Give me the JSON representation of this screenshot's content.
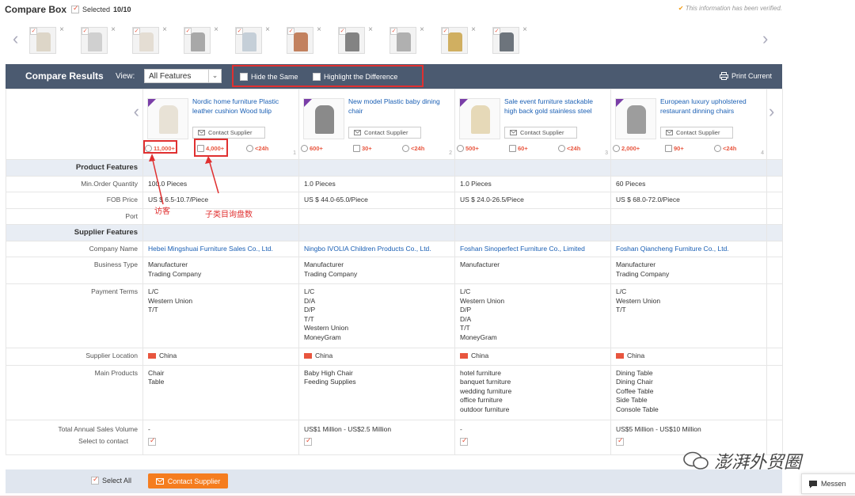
{
  "topbar": {
    "title": "Compare Box",
    "selected_label": "Selected",
    "selected_count": "10/10",
    "verified_text": "This information has been verified."
  },
  "thumbs": [
    "chair-white",
    "baby-chair",
    "chair-white-2",
    "chair-gray",
    "shelf",
    "chairs-multi",
    "room",
    "chair-gray-2",
    "chairs-multi-2",
    "dining-set"
  ],
  "header": {
    "title": "Compare Results",
    "view_label": "View:",
    "view_value": "All Features",
    "hide_same": "Hide the Same",
    "highlight_diff": "Highlight the Difference",
    "print": "Print Current"
  },
  "products": [
    {
      "name": "Nordic home furniture Plastic leather cushion Wood tulip",
      "contact": "Contact Supplier",
      "views": "11,000+",
      "inquiries": "4,000+",
      "response": "<24h",
      "index": "1"
    },
    {
      "name": "New model Plastic baby dining chair",
      "contact": "Contact Supplier",
      "views": "600+",
      "inquiries": "30+",
      "response": "<24h",
      "index": "2"
    },
    {
      "name": "Sale event furniture stackable high back gold stainless steel",
      "contact": "Contact Supplier",
      "views": "500+",
      "inquiries": "60+",
      "response": "<24h",
      "index": "3"
    },
    {
      "name": "European luxury upholstered restaurant dinning chairs",
      "contact": "Contact Supplier",
      "views": "2,000+",
      "inquiries": "90+",
      "response": "<24h",
      "index": "4"
    }
  ],
  "sections": {
    "product": "Product Features",
    "supplier": "Supplier Features"
  },
  "labels": {
    "moq": "Min.Order Quantity",
    "fob": "FOB Price",
    "port": "Port",
    "company": "Company Name",
    "business": "Business Type",
    "payment": "Payment Terms",
    "location": "Supplier Location",
    "main_products": "Main Products",
    "annual_sales": "Total Annual Sales Volume",
    "select_contact": "Select to contact"
  },
  "rows": {
    "moq": [
      "100.0 Pieces",
      "1.0 Pieces",
      "1.0 Pieces",
      "60 Pieces"
    ],
    "fob": [
      "US $ 6.5-10.7/Piece",
      "US $ 44.0-65.0/Piece",
      "US $ 24.0-26.5/Piece",
      "US $ 68.0-72.0/Piece"
    ],
    "company": [
      "Hebei Mingshuai Furniture Sales Co., Ltd.",
      "Ningbo IVOLIA Children Products Co., Ltd.",
      "Foshan Sinoperfect Furniture Co., Limited",
      "Foshan Qiancheng Furniture Co., Ltd."
    ],
    "business": [
      [
        "Manufacturer",
        "Trading Company"
      ],
      [
        "Manufacturer",
        "Trading Company"
      ],
      [
        "Manufacturer"
      ],
      [
        "Manufacturer",
        "Trading Company"
      ]
    ],
    "payment": [
      [
        "L/C",
        "Western Union",
        "T/T"
      ],
      [
        "L/C",
        "D/A",
        "D/P",
        "T/T",
        "Western Union",
        "MoneyGram"
      ],
      [
        "L/C",
        "Western Union",
        "D/P",
        "D/A",
        "T/T",
        "MoneyGram"
      ],
      [
        "L/C",
        "Western Union",
        "T/T"
      ]
    ],
    "location": [
      "China",
      "China",
      "China",
      "China"
    ],
    "main_products": [
      [
        "Chair",
        "Table"
      ],
      [
        "Baby High Chair",
        "Feeding Supplies"
      ],
      [
        "hotel furniture",
        "banquet furniture",
        "wedding furniture",
        "office furniture",
        "outdoor furniture"
      ],
      [
        "Dining Table",
        "Dining Chair",
        "Coffee Table",
        "Side Table",
        "Console Table"
      ]
    ],
    "annual_sales": [
      "-",
      "US$1 Million - US$2.5 Million",
      "-",
      "US$5 Million - US$10 Million"
    ]
  },
  "bottom": {
    "select_all": "Select All",
    "contact_button": "Contact Supplier"
  },
  "annotations": {
    "views_note": "访客",
    "inquiry_note": "子类目询盘数"
  },
  "watermark": "澎湃外贸圈",
  "messenger": "Messen"
}
